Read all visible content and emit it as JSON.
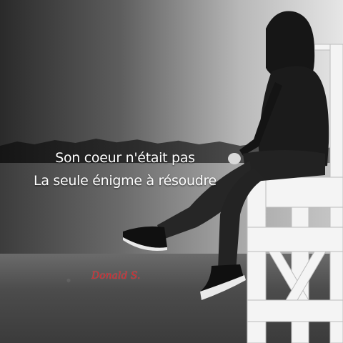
{
  "photo": {
    "caption_lines": [
      "Son coeur n'était pas",
      "La seule énigme à  résoudre"
    ],
    "signature": "Donald S.",
    "signature_color": "#d8242a",
    "palette": "black-and-white"
  }
}
